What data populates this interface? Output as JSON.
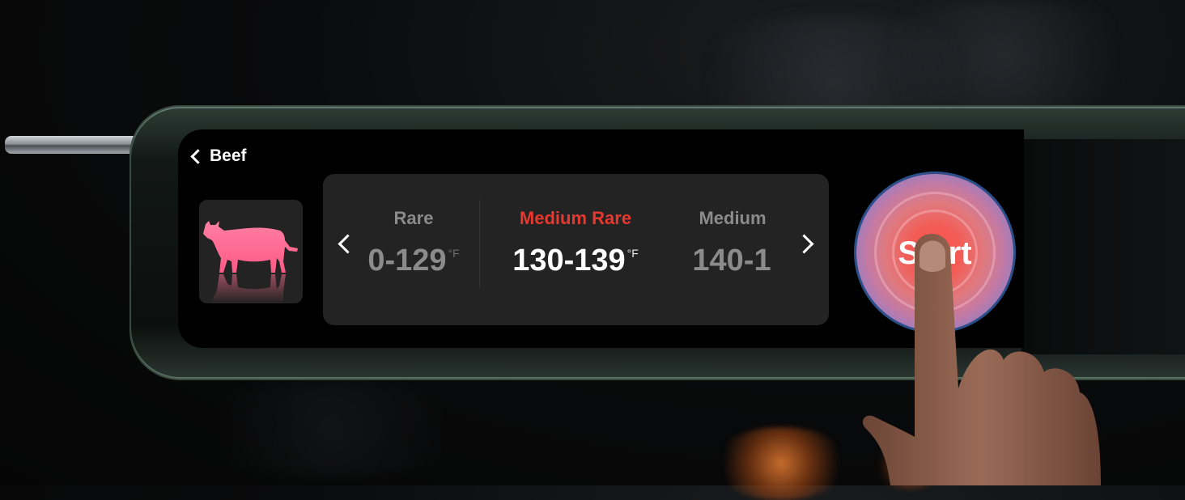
{
  "header": {
    "back_label": "Beef"
  },
  "category": {
    "icon": "cow-icon",
    "icon_color": "#ff6f96"
  },
  "doneness": {
    "levels": [
      {
        "label": "Rare",
        "range": "0-129",
        "unit": "°F"
      },
      {
        "label": "Medium Rare",
        "range": "130-139",
        "unit": "°F"
      },
      {
        "label": "Medium",
        "range": "140-1",
        "unit": ""
      }
    ],
    "selected": "Medium Rare",
    "selected_color": "#e6382f"
  },
  "action": {
    "start_label": "Start"
  }
}
